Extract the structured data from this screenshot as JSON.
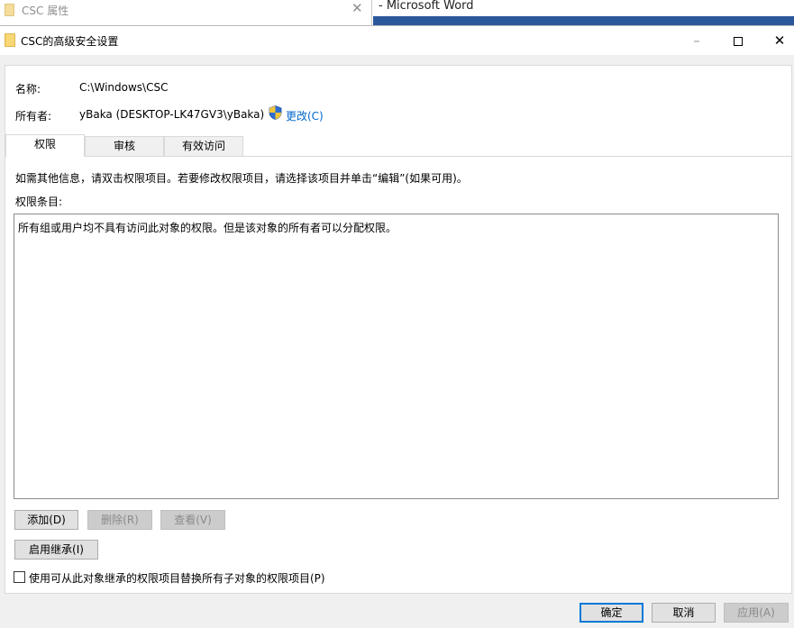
{
  "background": {
    "props_title": "CSC 属性",
    "word_title": "- Microsoft Word"
  },
  "dialog": {
    "title": "CSC的高级安全设置",
    "name_label": "名称:",
    "name_value": "C:\\Windows\\CSC",
    "owner_label": "所有者:",
    "owner_value": "yBaka (DESKTOP-LK47GV3\\yBaka)",
    "change_link": "更改(C)",
    "tabs": [
      {
        "label": "权限",
        "active": true
      },
      {
        "label": "审核",
        "active": false
      },
      {
        "label": "有效访问",
        "active": false
      }
    ],
    "info_text": "如需其他信息，请双击权限项目。若要修改权限项目，请选择该项目并单击“编辑”(如果可用)。",
    "entries_label": "权限条目:",
    "entries_message": "所有组或用户均不具有访问此对象的权限。但是该对象的所有者可以分配权限。",
    "buttons": {
      "add": "添加(D)",
      "remove": "删除(R)",
      "view": "查看(V)",
      "inherit": "启用继承(I)",
      "ok": "确定",
      "cancel": "取消",
      "apply": "应用(A)"
    },
    "replace_checkbox_label": "使用可从此对象继承的权限项目替换所有子对象的权限项目(P)",
    "replace_checkbox_checked": false
  },
  "colors": {
    "accent": "#0078d7",
    "link": "#0066cc",
    "word_ribbon": "#2b579a"
  }
}
